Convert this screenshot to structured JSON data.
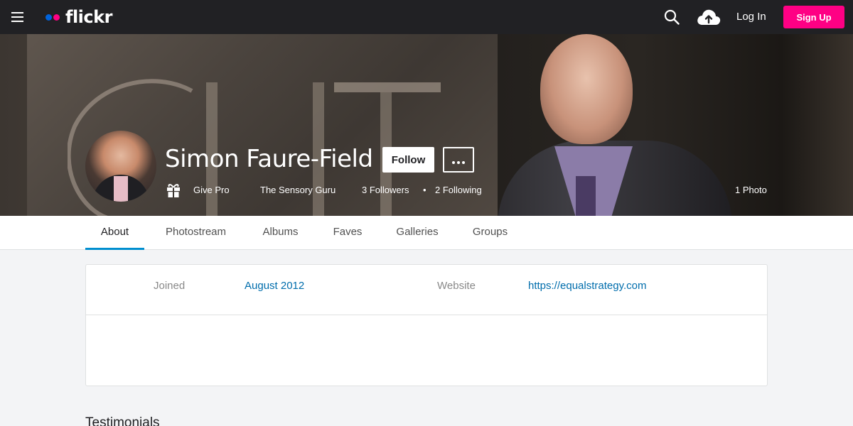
{
  "topnav": {
    "logo_text": "flickr",
    "logo_dot_colors": [
      "#0063dc",
      "#ff0084"
    ],
    "login_label": "Log In",
    "signup_label": "Sign Up",
    "signup_color": "#ff0084",
    "icons": [
      "menu-icon",
      "search-icon",
      "upload-cloud-icon"
    ]
  },
  "profile": {
    "name": "Simon Faure-Field",
    "follow_label": "Follow",
    "more_icon": "ellipsis-icon",
    "give_pro_label": "Give Pro",
    "real_name": "The Sensory Guru",
    "followers": "3 Followers",
    "separator": "•",
    "following": "2 Following",
    "photo_count": "1 Photo"
  },
  "tabs": [
    {
      "label": "About",
      "active": true
    },
    {
      "label": "Photostream",
      "active": false
    },
    {
      "label": "Albums",
      "active": false
    },
    {
      "label": "Faves",
      "active": false
    },
    {
      "label": "Galleries",
      "active": false
    },
    {
      "label": "Groups",
      "active": false
    }
  ],
  "about": {
    "joined_label": "Joined",
    "joined_value": "August 2012",
    "website_label": "Website",
    "website_value": "https://equalstrategy.com"
  },
  "sections": {
    "testimonials_title": "Testimonials"
  },
  "colors": {
    "accent_tab": "#008ecf",
    "link": "#006dac",
    "nav_bg": "#212124"
  }
}
